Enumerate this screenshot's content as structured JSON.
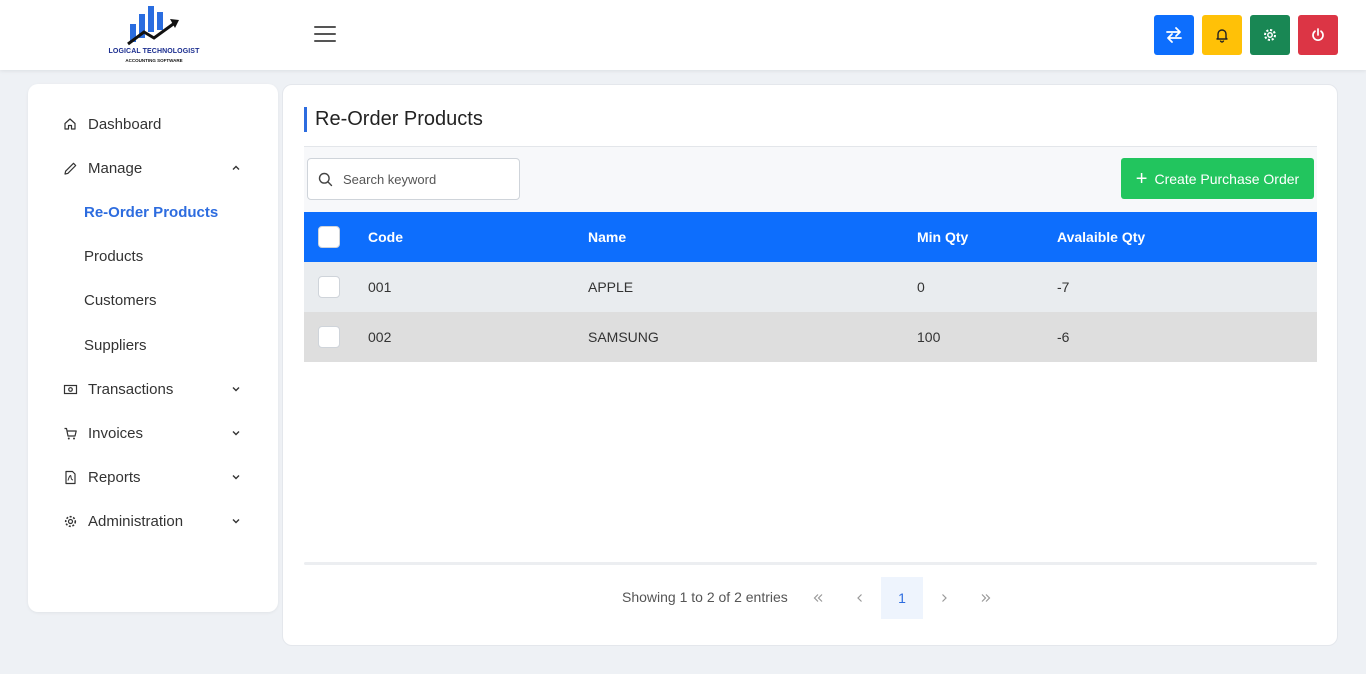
{
  "app": {
    "brand": "LOGICAL TECHNOLOGIST",
    "tagline": "ACCOUNTING SOFTWARE"
  },
  "header": {
    "buttons": [
      {
        "name": "swap",
        "icon": "swap-arrows-icon",
        "color": "#0d6efd"
      },
      {
        "name": "notifications",
        "icon": "bell-icon",
        "color": "#ffc107"
      },
      {
        "name": "settings",
        "icon": "gear-icon",
        "color": "#198754"
      },
      {
        "name": "logout",
        "icon": "power-icon",
        "color": "#dc3545"
      }
    ]
  },
  "sidebar": {
    "dashboard": "Dashboard",
    "manage": "Manage",
    "manage_children": [
      "Re-Order Products",
      "Products",
      "Customers",
      "Suppliers"
    ],
    "transactions": "Transactions",
    "invoices": "Invoices",
    "reports": "Reports",
    "administration": "Administration"
  },
  "page": {
    "title": "Re-Order Products",
    "search_placeholder": "Search keyword",
    "create_button": "Create Purchase Order"
  },
  "table": {
    "columns": [
      "Code",
      "Name",
      "Min Qty",
      "Avalaible Qty"
    ],
    "rows": [
      {
        "code": "001",
        "name": "APPLE",
        "min_qty": "0",
        "available_qty": "-7"
      },
      {
        "code": "002",
        "name": "SAMSUNG",
        "min_qty": "100",
        "available_qty": "-6"
      }
    ]
  },
  "pagination": {
    "showing": "Showing 1 to 2 of 2 entries",
    "current_page": "1"
  },
  "colors": {
    "accent": "#2d6cdf",
    "table_header": "#0d6efd",
    "create_button": "#22c55e"
  }
}
